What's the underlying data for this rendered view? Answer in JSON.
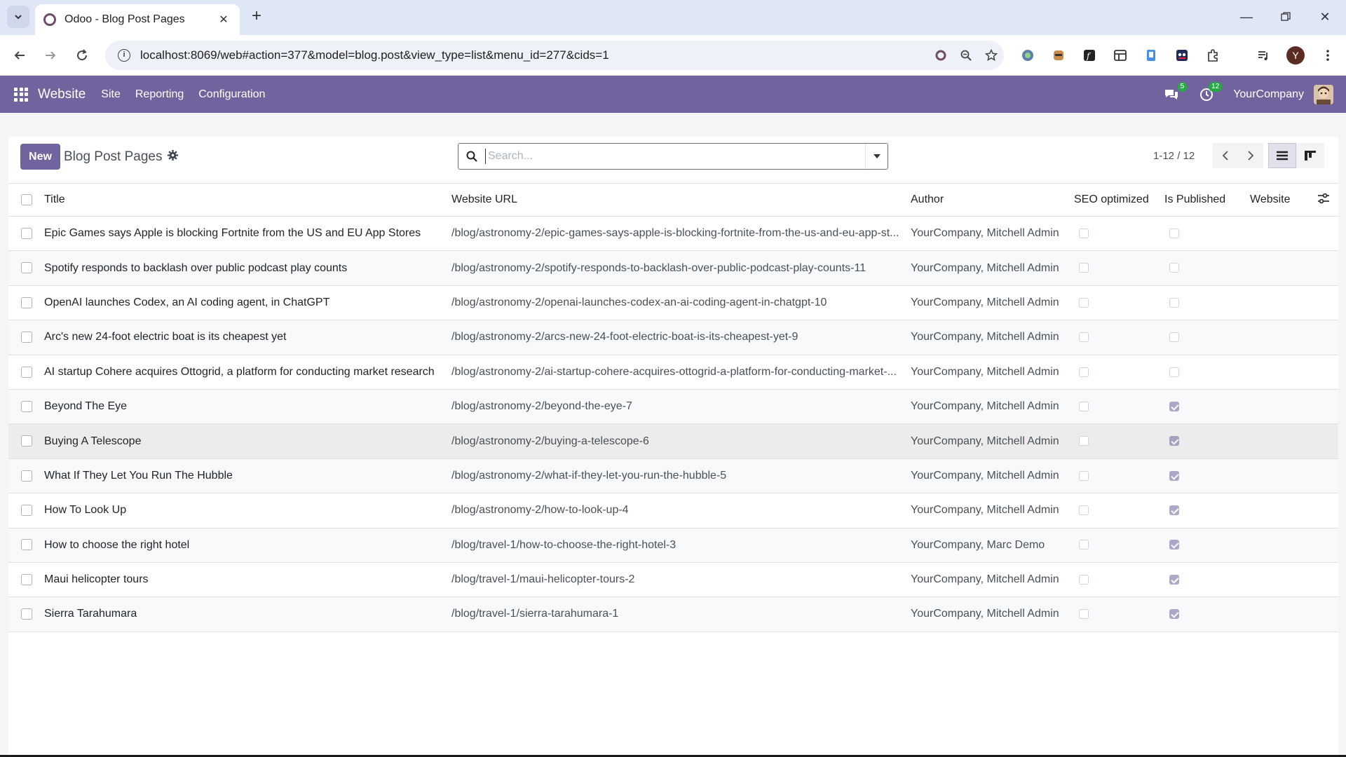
{
  "browser": {
    "tab_title": "Odoo - Blog Post Pages",
    "url": "localhost:8069/web#action=377&model=blog.post&view_type=list&menu_id=277&cids=1",
    "profile_initial": "Y"
  },
  "navbar": {
    "brand": "Website",
    "menu": [
      "Site",
      "Reporting",
      "Configuration"
    ],
    "messages_count": "5",
    "activities_count": "12",
    "company": "YourCompany"
  },
  "control_panel": {
    "new_label": "New",
    "title": "Blog Post Pages",
    "search_placeholder": "Search...",
    "pager": "1-12 / 12"
  },
  "table": {
    "headers": {
      "title": "Title",
      "url": "Website URL",
      "author": "Author",
      "seo": "SEO optimized",
      "published": "Is Published",
      "website": "Website"
    },
    "rows": [
      {
        "title": "Epic Games says Apple is blocking Fortnite from the US and EU App Stores",
        "url": "/blog/astronomy-2/epic-games-says-apple-is-blocking-fortnite-from-the-us-and-eu-app-st...",
        "author": "YourCompany, Mitchell Admin",
        "seo": false,
        "published": false,
        "website": ""
      },
      {
        "title": "Spotify responds to backlash over public podcast play counts",
        "url": "/blog/astronomy-2/spotify-responds-to-backlash-over-public-podcast-play-counts-11",
        "author": "YourCompany, Mitchell Admin",
        "seo": false,
        "published": false,
        "website": ""
      },
      {
        "title": "OpenAI launches Codex, an AI coding agent, in ChatGPT",
        "url": "/blog/astronomy-2/openai-launches-codex-an-ai-coding-agent-in-chatgpt-10",
        "author": "YourCompany, Mitchell Admin",
        "seo": false,
        "published": false,
        "website": ""
      },
      {
        "title": "Arc's new 24-foot electric boat is its cheapest yet",
        "url": "/blog/astronomy-2/arcs-new-24-foot-electric-boat-is-its-cheapest-yet-9",
        "author": "YourCompany, Mitchell Admin",
        "seo": false,
        "published": false,
        "website": ""
      },
      {
        "title": "AI startup Cohere acquires Ottogrid, a platform for conducting market research",
        "url": "/blog/astronomy-2/ai-startup-cohere-acquires-ottogrid-a-platform-for-conducting-market-...",
        "author": "YourCompany, Mitchell Admin",
        "seo": false,
        "published": false,
        "website": ""
      },
      {
        "title": "Beyond The Eye",
        "url": "/blog/astronomy-2/beyond-the-eye-7",
        "author": "YourCompany, Mitchell Admin",
        "seo": false,
        "published": true,
        "website": ""
      },
      {
        "title": "Buying A Telescope",
        "url": "/blog/astronomy-2/buying-a-telescope-6",
        "author": "YourCompany, Mitchell Admin",
        "seo": false,
        "published": true,
        "website": ""
      },
      {
        "title": "What If They Let You Run The Hubble",
        "url": "/blog/astronomy-2/what-if-they-let-you-run-the-hubble-5",
        "author": "YourCompany, Mitchell Admin",
        "seo": false,
        "published": true,
        "website": ""
      },
      {
        "title": "How To Look Up",
        "url": "/blog/astronomy-2/how-to-look-up-4",
        "author": "YourCompany, Mitchell Admin",
        "seo": false,
        "published": true,
        "website": ""
      },
      {
        "title": "How to choose the right hotel",
        "url": "/blog/travel-1/how-to-choose-the-right-hotel-3",
        "author": "YourCompany, Marc Demo",
        "seo": false,
        "published": true,
        "website": ""
      },
      {
        "title": "Maui helicopter tours",
        "url": "/blog/travel-1/maui-helicopter-tours-2",
        "author": "YourCompany, Mitchell Admin",
        "seo": false,
        "published": true,
        "website": ""
      },
      {
        "title": "Sierra Tarahumara",
        "url": "/blog/travel-1/sierra-tarahumara-1",
        "author": "YourCompany, Mitchell Admin",
        "seo": false,
        "published": true,
        "website": ""
      }
    ]
  },
  "colors": {
    "navbar": "#71639e",
    "primary_button": "#71639e"
  }
}
